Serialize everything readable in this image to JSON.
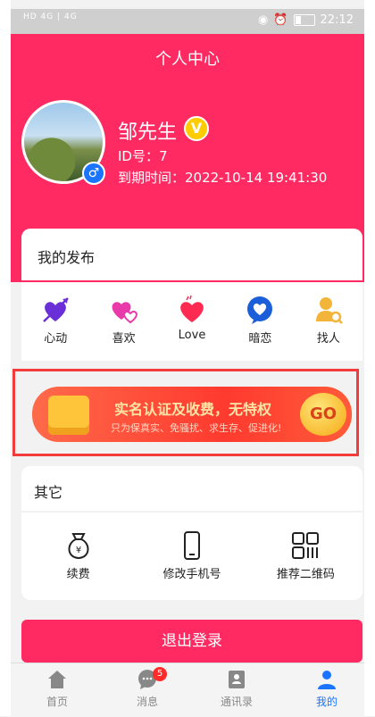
{
  "status": {
    "signal": "HD 4G | 4G",
    "time": "22:12"
  },
  "header": {
    "title": "个人中心"
  },
  "profile": {
    "name": "邹先生",
    "vip_mark": "V",
    "gender_mark": "♂",
    "id_line": "ID号：7",
    "expire_line": "到期时间：2022-10-14 19:41:30"
  },
  "my_posts": {
    "title": "我的发布",
    "items": [
      {
        "label": "心动",
        "icon": "heart-arrow-icon"
      },
      {
        "label": "喜欢",
        "icon": "double-heart-icon"
      },
      {
        "label": "Love",
        "icon": "heart-icon"
      },
      {
        "label": "暗恋",
        "icon": "heart-bubble-icon"
      },
      {
        "label": "找人",
        "icon": "user-search-icon"
      }
    ]
  },
  "banner": {
    "title": "实名认证及收费，无特权",
    "subtitle": "只为保真实、免骚扰、求生存、促进化!",
    "go_label": "GO"
  },
  "others": {
    "title": "其它",
    "items": [
      {
        "label": "续费",
        "icon": "money-bag-icon"
      },
      {
        "label": "修改手机号",
        "icon": "phone-icon"
      },
      {
        "label": "推荐二维码",
        "icon": "qrcode-icon"
      }
    ]
  },
  "logout_label": "退出登录",
  "tabbar": {
    "tabs": [
      {
        "label": "首页",
        "icon": "home-icon"
      },
      {
        "label": "消息",
        "icon": "chat-icon",
        "badge": "5"
      },
      {
        "label": "通讯录",
        "icon": "contacts-icon"
      },
      {
        "label": "我的",
        "icon": "user-icon",
        "active": true
      }
    ]
  },
  "colors": {
    "brand": "#ff2a62",
    "active_tab": "#1a74ff",
    "highlight_border": "#f23b3b"
  }
}
